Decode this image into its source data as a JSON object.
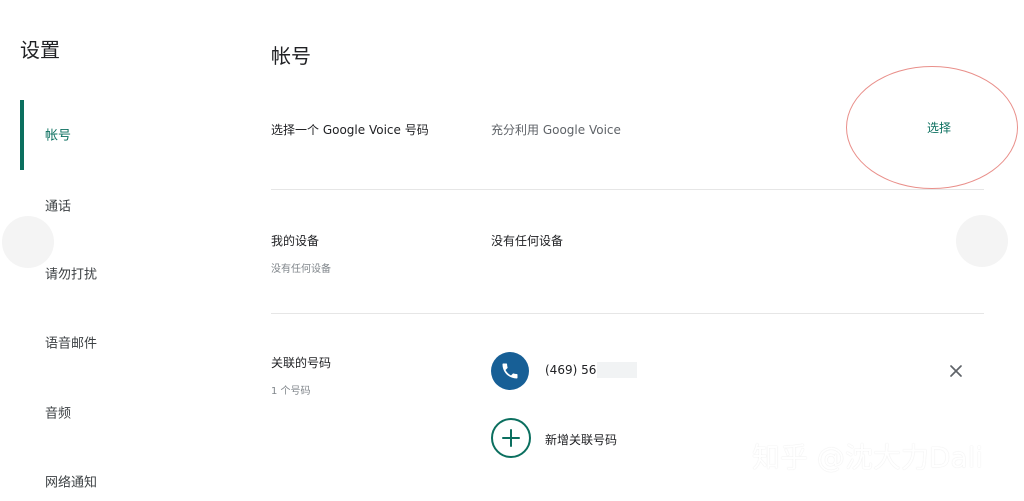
{
  "sidebar": {
    "title": "设置",
    "items": [
      {
        "label": "帐号"
      },
      {
        "label": "通话"
      },
      {
        "label": "请勿打扰"
      },
      {
        "label": "语音邮件"
      },
      {
        "label": "音频"
      },
      {
        "label": "网络通知"
      }
    ]
  },
  "main": {
    "title": "帐号",
    "sections": [
      {
        "label": "选择一个 Google Voice 号码",
        "description": "充分利用 Google Voice",
        "action": "选择"
      },
      {
        "label": "我的设备",
        "sublabel": "没有任何设备",
        "description": "没有任何设备"
      },
      {
        "label": "关联的号码",
        "sublabel": "1 个号码",
        "phone": "(469) 565-",
        "add_label": "新增关联号码"
      }
    ]
  },
  "icons": {
    "phone": "phone-icon",
    "close": "close-icon",
    "add": "add-icon"
  },
  "colors": {
    "accent": "#0b6f5f",
    "phone_avatar": "#175f96",
    "annotation": "#e98f8a"
  },
  "watermark": "知乎 @沈大力Dali"
}
